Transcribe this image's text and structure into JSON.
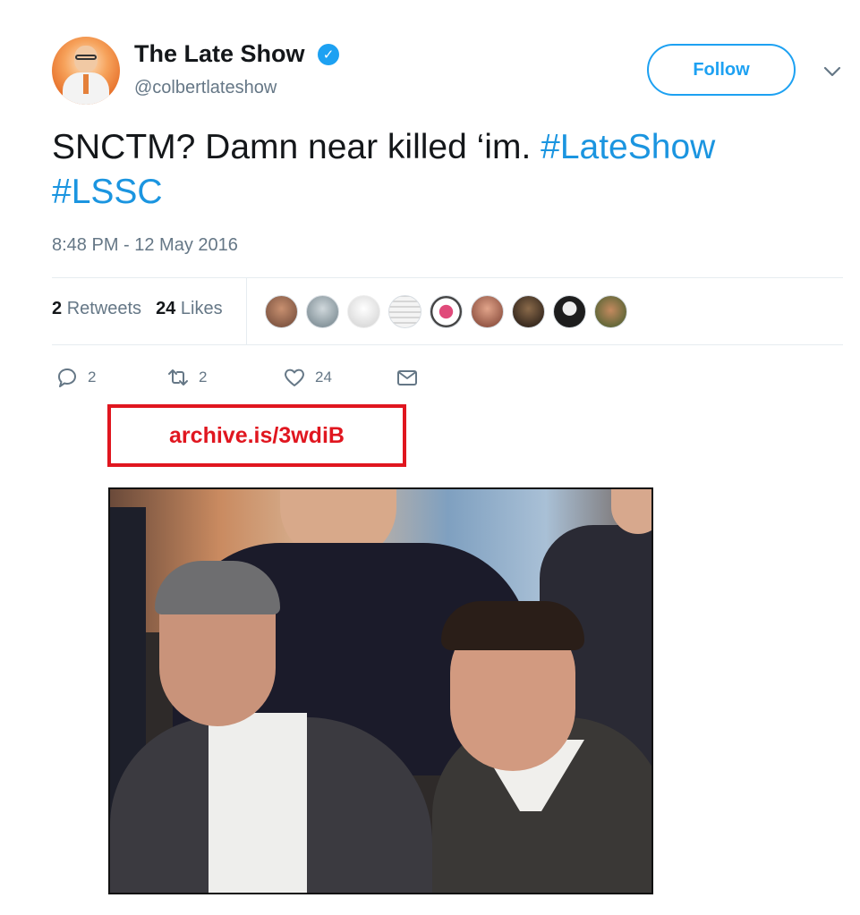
{
  "tweet": {
    "author": {
      "name": "The Late Show",
      "handle": "@colbertlateshow",
      "verified_icon": "verified-badge-icon"
    },
    "follow_label": "Follow",
    "text": {
      "plain": "SNCTM? Damn near killed ‘im.",
      "hashtag_1": "#LateShow",
      "hashtag_2": "#LSSC"
    },
    "timestamp": "8:48 PM - 12 May 2016",
    "stats": {
      "retweets_count": "2",
      "retweets_label": "Retweets",
      "likes_count": "24",
      "likes_label": "Likes"
    },
    "actions": {
      "reply_count": "2",
      "retweet_count": "2",
      "like_count": "24"
    }
  },
  "annotation": {
    "archive_link": "archive.is/3wdiB"
  },
  "colors": {
    "accent": "#1da1f2",
    "hashtag": "#1b95e0",
    "muted": "#657786",
    "annotation_red": "#e0161f"
  }
}
